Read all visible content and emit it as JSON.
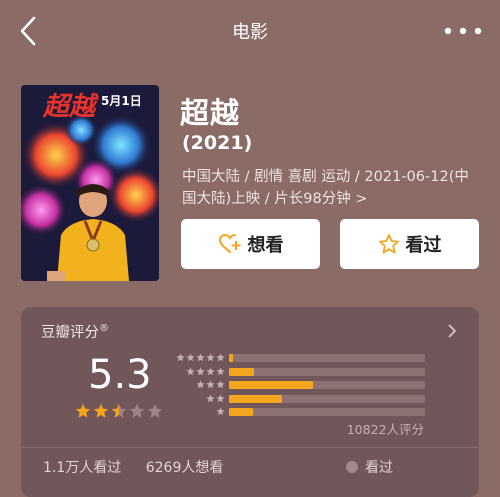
{
  "nav": {
    "title": "电影",
    "back_icon": "chevron-left-icon",
    "more_icon": "more-dots-icon"
  },
  "poster": {
    "overlay_title": "超越",
    "overlay_date": "5月1日",
    "colors": [
      "#1c1a3b",
      "#e23f2f",
      "#f7c13a",
      "#2fb3d3"
    ]
  },
  "movie": {
    "title": "超越",
    "year": "(2021)",
    "meta_line1": "中国大陆 / 剧情 喜剧 运动 / 2021-06-12(中",
    "meta_line2": "国大陆)上映 / 片长98分钟",
    "meta_arrow": ">"
  },
  "actions": {
    "want": {
      "label": "想看",
      "icon": "heart-plus-icon",
      "icon_color": "#f3a51f"
    },
    "seen": {
      "label": "看过",
      "icon": "star-outline-icon",
      "icon_color": "#f3a51f"
    }
  },
  "rating": {
    "label": "豆瓣评分",
    "label_mark": "®",
    "score": "5.3",
    "stars_filled": 2.5,
    "star_color": "#f3a51f",
    "count": "10822人评分",
    "distribution": [
      {
        "stars": 5,
        "fraction": 0.02
      },
      {
        "stars": 4,
        "fraction": 0.13
      },
      {
        "stars": 3,
        "fraction": 0.43
      },
      {
        "stars": 2,
        "fraction": 0.27
      },
      {
        "stars": 1,
        "fraction": 0.12
      }
    ]
  },
  "footer": {
    "watched": "1.1万人看过",
    "want": "6269人想看",
    "seen_label": "看过"
  }
}
